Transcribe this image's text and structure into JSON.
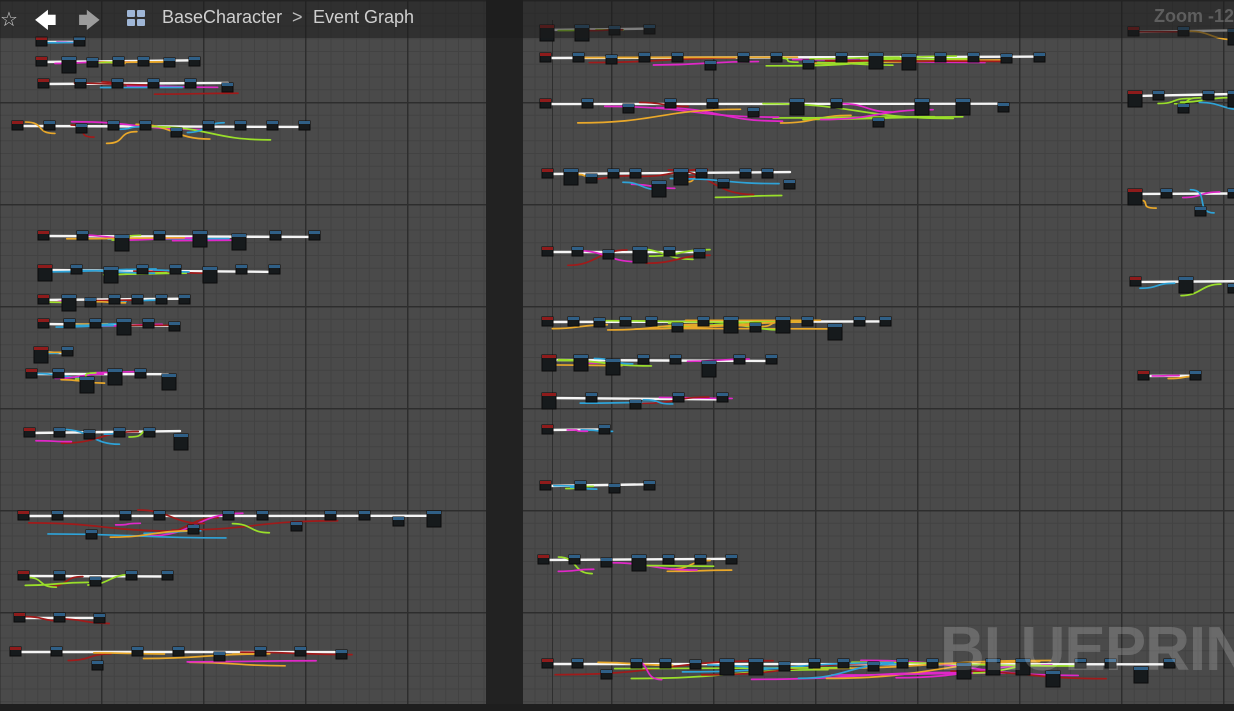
{
  "toolbar": {
    "favorite_icon": "star-outline-icon",
    "back_icon": "arrow-left-icon",
    "forward_icon": "arrow-right-icon",
    "graph_icon": "blueprint-grid-icon",
    "breadcrumb": [
      "BaseCharacter",
      "Event Graph"
    ],
    "separator": ">",
    "zoom": "Zoom -12"
  },
  "watermark": "BLUEPRINT",
  "colors": {
    "exec_wire": "#f5f5f5",
    "float_wire": "#9adf2a",
    "object_wire": "#2ea3d8",
    "byte_wire": "#e027c8",
    "bool_wire": "#a11a1a",
    "enum_wire": "#e9a82a",
    "event_node_header": "#8e1b1b",
    "function_node_header": "#2f5f86",
    "grid_background": "#4a4a4a"
  }
}
